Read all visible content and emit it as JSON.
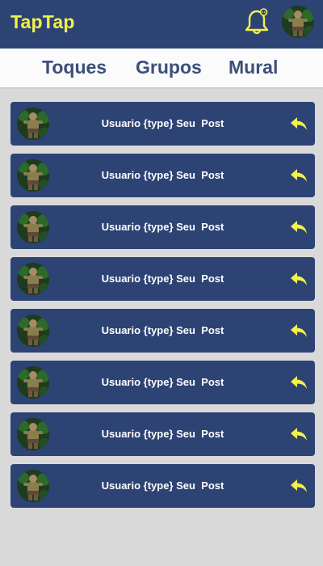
{
  "header": {
    "brand": "TapTap",
    "bell_icon": "bell-with-badge-icon",
    "profile_avatar": "user-avatar"
  },
  "tabs": [
    {
      "label": "Toques"
    },
    {
      "label": "Grupos"
    },
    {
      "label": "Mural"
    }
  ],
  "notifications": [
    {
      "text": "Usuario {type} Seu  Post",
      "action_icon": "reply-icon"
    },
    {
      "text": "Usuario {type} Seu  Post",
      "action_icon": "reply-icon"
    },
    {
      "text": "Usuario {type} Seu  Post",
      "action_icon": "reply-icon"
    },
    {
      "text": "Usuario {type} Seu  Post",
      "action_icon": "reply-icon"
    },
    {
      "text": "Usuario {type} Seu  Post",
      "action_icon": "reply-icon"
    },
    {
      "text": "Usuario {type} Seu  Post",
      "action_icon": "reply-icon"
    },
    {
      "text": "Usuario {type} Seu  Post",
      "action_icon": "reply-icon"
    },
    {
      "text": "Usuario {type} Seu  Post",
      "action_icon": "reply-icon"
    }
  ],
  "colors": {
    "header_bg": "#2d4374",
    "accent_yellow": "#f2f24a",
    "tab_text": "#3c4f7a",
    "page_bg": "#d9d9d9",
    "card_bg": "#2d4374"
  }
}
